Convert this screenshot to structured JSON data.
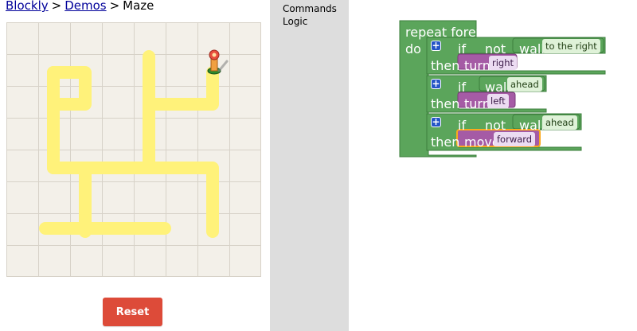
{
  "breadcrumb": {
    "blockly": "Blockly",
    "sep1": ">",
    "demos": "Demos",
    "sep2": ">",
    "current": "Maze"
  },
  "reset_label": "Reset",
  "toolbox": {
    "categories": [
      "Commands",
      "Logic"
    ]
  },
  "colors": {
    "path": "#fff27a",
    "green_block": "#5ba55b",
    "purple_block": "#a55ba5",
    "selected": "#fba91d",
    "reset": "#dd4b39",
    "plus_button": "#2455c6"
  },
  "program": {
    "repeat": {
      "label": "repeat forever",
      "do": "do"
    },
    "if1": {
      "if": "if",
      "not": "not",
      "wall": "wall",
      "direction": "to the right",
      "then": "then",
      "action": "turn",
      "action_value": "right"
    },
    "if2": {
      "if": "if",
      "wall": "wall",
      "direction": "ahead",
      "then": "then",
      "action": "turn",
      "action_value": "left"
    },
    "if3": {
      "if": "if",
      "not": "not",
      "wall": "wall",
      "direction": "ahead",
      "then": "then",
      "action": "move",
      "action_value": "forward"
    }
  }
}
